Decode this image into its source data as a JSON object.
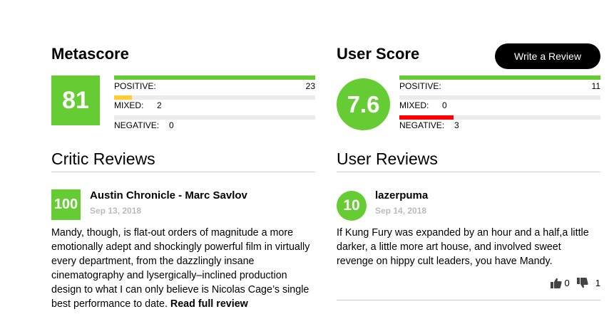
{
  "metascore": {
    "heading": "Metascore",
    "score": "81",
    "distribution": [
      {
        "label": "POSITIVE:",
        "count": "23",
        "fraction": 1.0,
        "color": "#66cc33"
      },
      {
        "label": "MIXED:",
        "count": "2",
        "fraction": 0.09,
        "color": "#ffcc33"
      },
      {
        "label": "NEGATIVE:",
        "count": "0",
        "fraction": 0.0,
        "color": "#ff0000"
      }
    ]
  },
  "userscore": {
    "heading": "User Score",
    "write_review_label": "Write a Review",
    "score": "7.6",
    "distribution": [
      {
        "label": "POSITIVE:",
        "count": "11",
        "fraction": 1.0,
        "color": "#66cc33"
      },
      {
        "label": "MIXED:",
        "count": "0",
        "fraction": 0.0,
        "color": "#ffcc33"
      },
      {
        "label": "NEGATIVE:",
        "count": "3",
        "fraction": 0.27,
        "color": "#ff0000"
      }
    ]
  },
  "critic_reviews": {
    "heading": "Critic Reviews",
    "items": [
      {
        "score": "100",
        "author": "Austin Chronicle - Marc Savlov",
        "date": "Sep 13, 2018",
        "text": "Mandy, though, is flat-out orders of magnitude a more emotionally adept and shockingly powerful film in virtually every department, from the dazzlingly insane cinematography and lysergically–inclined production design to what I can only believe is Nicolas Cage’s single best performance to date.",
        "read_more": "Read full review"
      }
    ]
  },
  "user_reviews": {
    "heading": "User Reviews",
    "items": [
      {
        "score": "10",
        "author": "lazerpuma",
        "date": "Sep 14, 2018",
        "text": "If Kung Fury was expanded by an hour and a half,a little darker, a little more art house, and involved sweet revenge on hippy cult leaders, you have Mandy.",
        "thumbs_up": "0",
        "thumbs_down": "1"
      }
    ]
  }
}
